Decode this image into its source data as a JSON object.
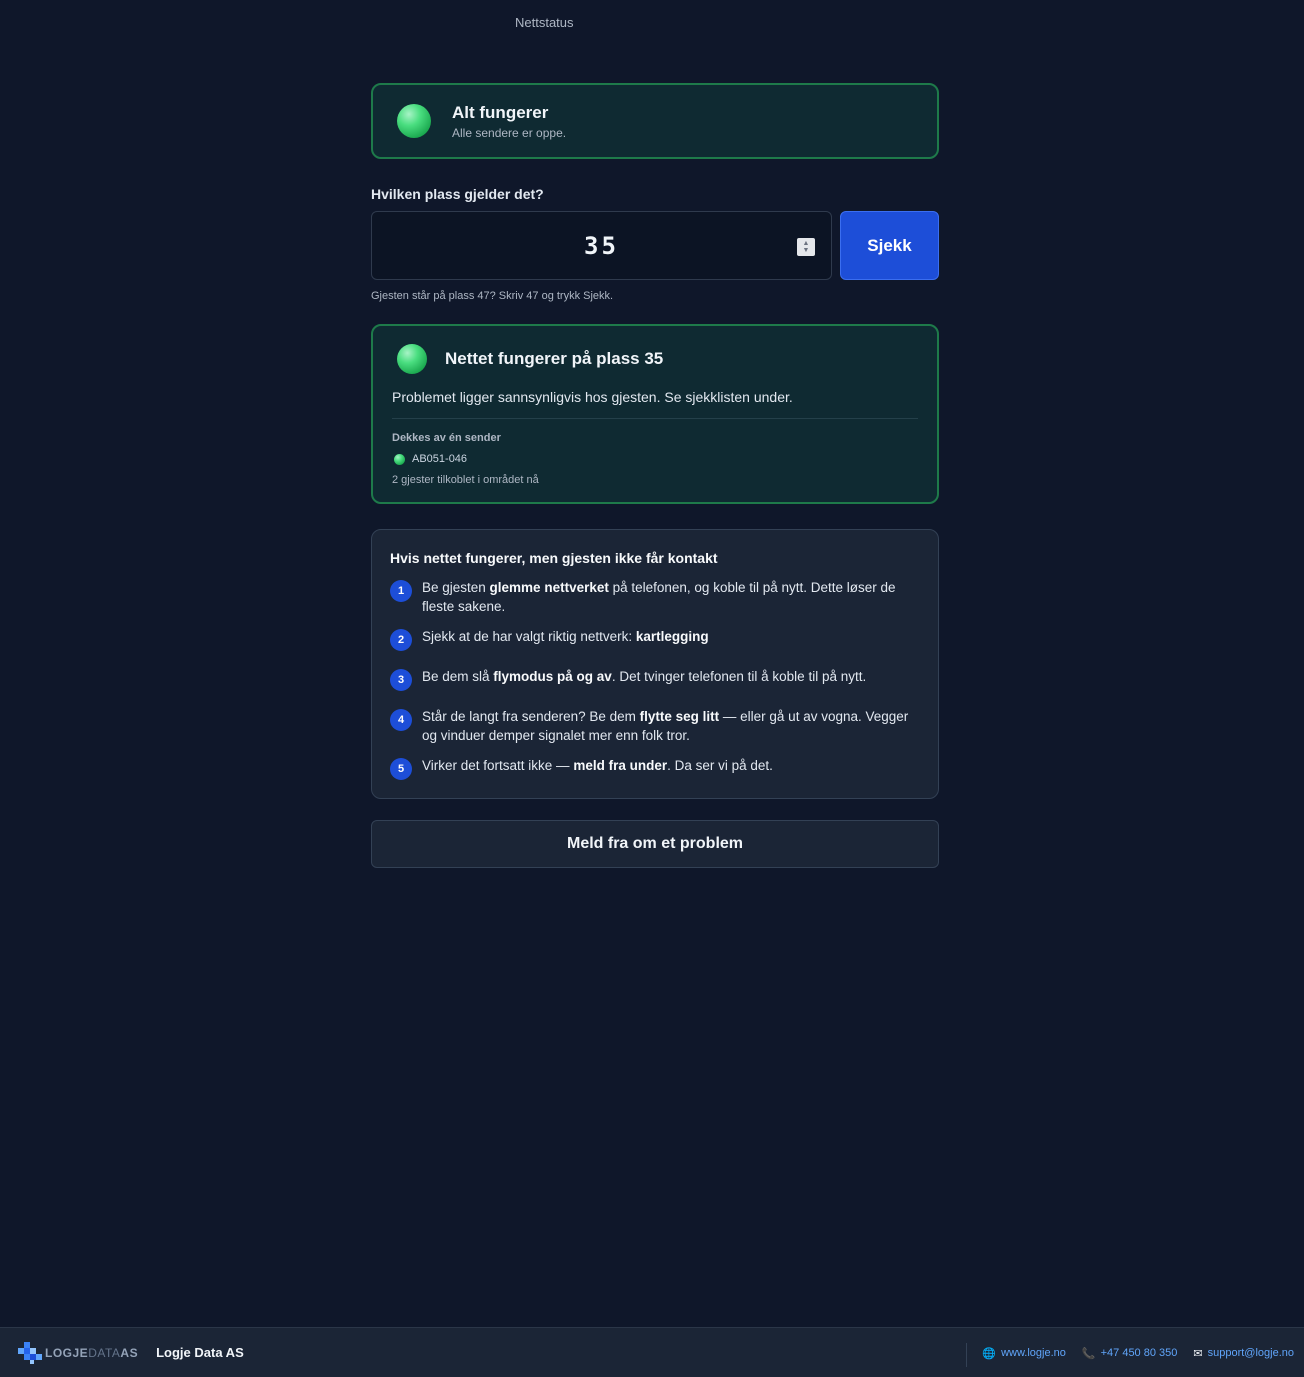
{
  "page": {
    "title": "Nettstatus"
  },
  "status": {
    "title": "Alt fungerer",
    "subtitle": "Alle sendere er oppe."
  },
  "lookup": {
    "label": "Hvilken plass gjelder det?",
    "value": "35",
    "button_label": "Sjekk",
    "hint": "Gjesten står på plass 47? Skriv 47 og trykk Sjekk."
  },
  "result": {
    "title": "Nettet fungerer på plass 35",
    "description": "Problemet ligger sannsynligvis hos gjesten. Se sjekklisten under.",
    "coverage_label": "Dekkes av én sender",
    "sender": "AB051-046",
    "guests": "2 gjester tilkoblet i området nå"
  },
  "checklist": {
    "title": "Hvis nettet fungerer, men gjesten ikke får kontakt",
    "steps": [
      {
        "num": "1",
        "pre": "Be gjesten ",
        "bold": "glemme nettverket",
        "post": " på telefonen, og koble til på nytt. Dette løser de fleste sakene."
      },
      {
        "num": "2",
        "pre": "Sjekk at de har valgt riktig nettverk: ",
        "bold": "kartlegging",
        "post": ""
      },
      {
        "num": "3",
        "pre": "Be dem slå ",
        "bold": "flymodus på og av",
        "post": ". Det tvinger telefonen til å koble til på nytt."
      },
      {
        "num": "4",
        "pre": "Står de langt fra senderen? Be dem ",
        "bold": "flytte seg litt",
        "post": " — eller gå ut av vogna. Vegger og vinduer demper signalet mer enn folk tror."
      },
      {
        "num": "5",
        "pre": "Virker det fortsatt ikke — ",
        "bold": "meld fra under",
        "post": ". Da ser vi på det."
      }
    ]
  },
  "report_button": "Meld fra om et problem",
  "footer": {
    "logo_part1": "LOGJE",
    "logo_part2": "DATA",
    "logo_part3": "AS",
    "company": "Logje Data AS",
    "website": "www.logje.no",
    "phone": "+47 450 80 350",
    "email": "support@logje.no",
    "icons": {
      "website": "globe-icon",
      "phone": "phone-icon",
      "email": "envelope-icon"
    }
  },
  "colors": {
    "accent": "#1d4ed8",
    "ok_border": "#1e7a4a",
    "ok_green": "#4ade80",
    "background": "#0f172a",
    "link": "#60a5fa"
  }
}
